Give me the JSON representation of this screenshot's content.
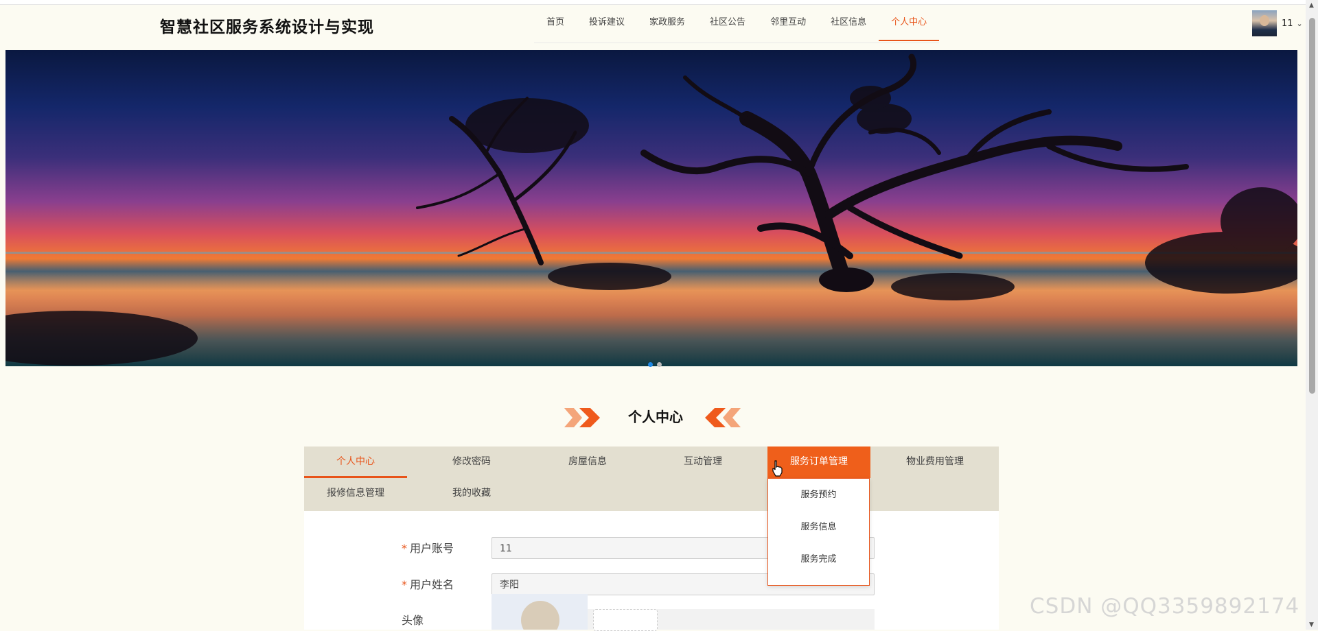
{
  "header": {
    "title": "智慧社区服务系统设计与实现",
    "nav": [
      {
        "label": "首页"
      },
      {
        "label": "投诉建议"
      },
      {
        "label": "家政服务"
      },
      {
        "label": "社区公告"
      },
      {
        "label": "邻里互动"
      },
      {
        "label": "社区信息"
      },
      {
        "label": "个人中心",
        "active": true
      }
    ],
    "user": {
      "name": "11",
      "chevron_icon": "chevron-down-icon"
    }
  },
  "banner": {
    "active_slide": 1,
    "slides": 2
  },
  "section": {
    "title": "个人中心"
  },
  "tabs": [
    {
      "label": "个人中心",
      "active": true
    },
    {
      "label": "修改密码"
    },
    {
      "label": "房屋信息"
    },
    {
      "label": "互动管理"
    },
    {
      "label": "服务订单管理",
      "hover": true
    },
    {
      "label": "物业费用管理"
    },
    {
      "label": "报修信息管理"
    },
    {
      "label": "我的收藏"
    }
  ],
  "dropdown": {
    "items": [
      {
        "label": "服务预约"
      },
      {
        "label": "服务信息"
      },
      {
        "label": "服务完成"
      }
    ]
  },
  "form": {
    "account_label": "用户账号",
    "account_value": "11",
    "name_label": "用户姓名",
    "name_value": "李阳",
    "avatar_label": "头像",
    "required_mark": "*"
  },
  "watermark": "CSDN @QQ3359892174",
  "colors": {
    "accent": "#e8541a",
    "tabs_bg": "#e3dfd0",
    "page_bg": "#fcfbf2"
  }
}
